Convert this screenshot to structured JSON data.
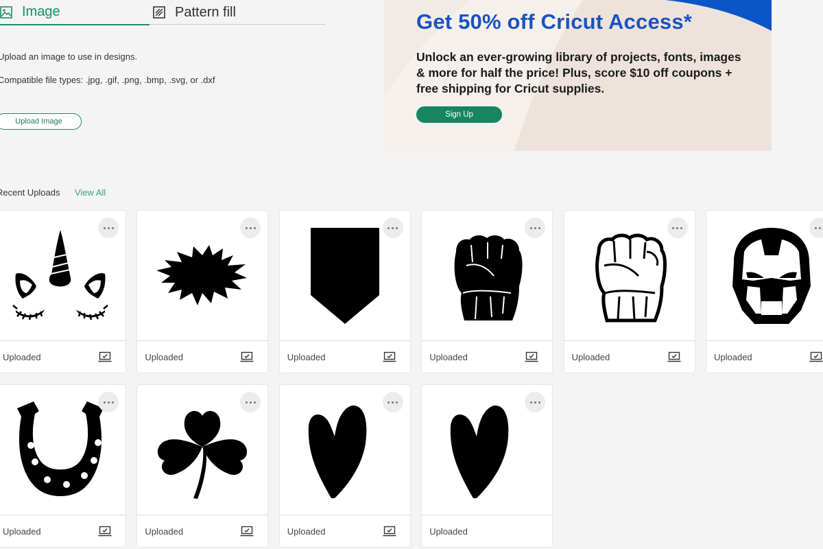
{
  "tabs": [
    {
      "label": "Image",
      "icon": "image-icon",
      "active": true
    },
    {
      "label": "Pattern fill",
      "icon": "pattern-fill-icon",
      "active": false
    }
  ],
  "upload": {
    "description": "Upload an image to use in designs.",
    "file_types": "Compatible file types: .jpg, .gif, .png, .bmp, .svg, or .dxf",
    "button_label": "Upload Image"
  },
  "banner": {
    "title": "Get 50% off Cricut Access*",
    "body": "Unlock an ever-growing library of projects, fonts, images & more for half the price! Plus, score $10 off coupons + free shipping for Cricut supplies.",
    "button_label": "Sign Up",
    "colors": {
      "title": "#1a52c4",
      "button": "#168560",
      "accent": "#0a55c8"
    }
  },
  "recent": {
    "label": "Recent Uploads",
    "view_all": "View All"
  },
  "uploads": [
    {
      "name": "unicorn-face",
      "status": "Uploaded",
      "has_device_icon": true
    },
    {
      "name": "starburst",
      "status": "Uploaded",
      "has_device_icon": true
    },
    {
      "name": "pennant",
      "status": "Uploaded",
      "has_device_icon": true
    },
    {
      "name": "fist-silhouette",
      "status": "Uploaded",
      "has_device_icon": true
    },
    {
      "name": "fist-outline",
      "status": "Uploaded",
      "has_device_icon": true
    },
    {
      "name": "iron-man-mask",
      "status": "Uploaded",
      "has_device_icon": true
    },
    {
      "name": "horseshoe",
      "status": "Uploaded",
      "has_device_icon": true
    },
    {
      "name": "shamrock",
      "status": "Uploaded",
      "has_device_icon": true
    },
    {
      "name": "heart",
      "status": "Uploaded",
      "has_device_icon": true
    },
    {
      "name": "heart",
      "status": "Uploaded",
      "has_device_icon": false
    }
  ],
  "theme": {
    "accent": "#1e8a66",
    "background": "#f4f4f4"
  }
}
